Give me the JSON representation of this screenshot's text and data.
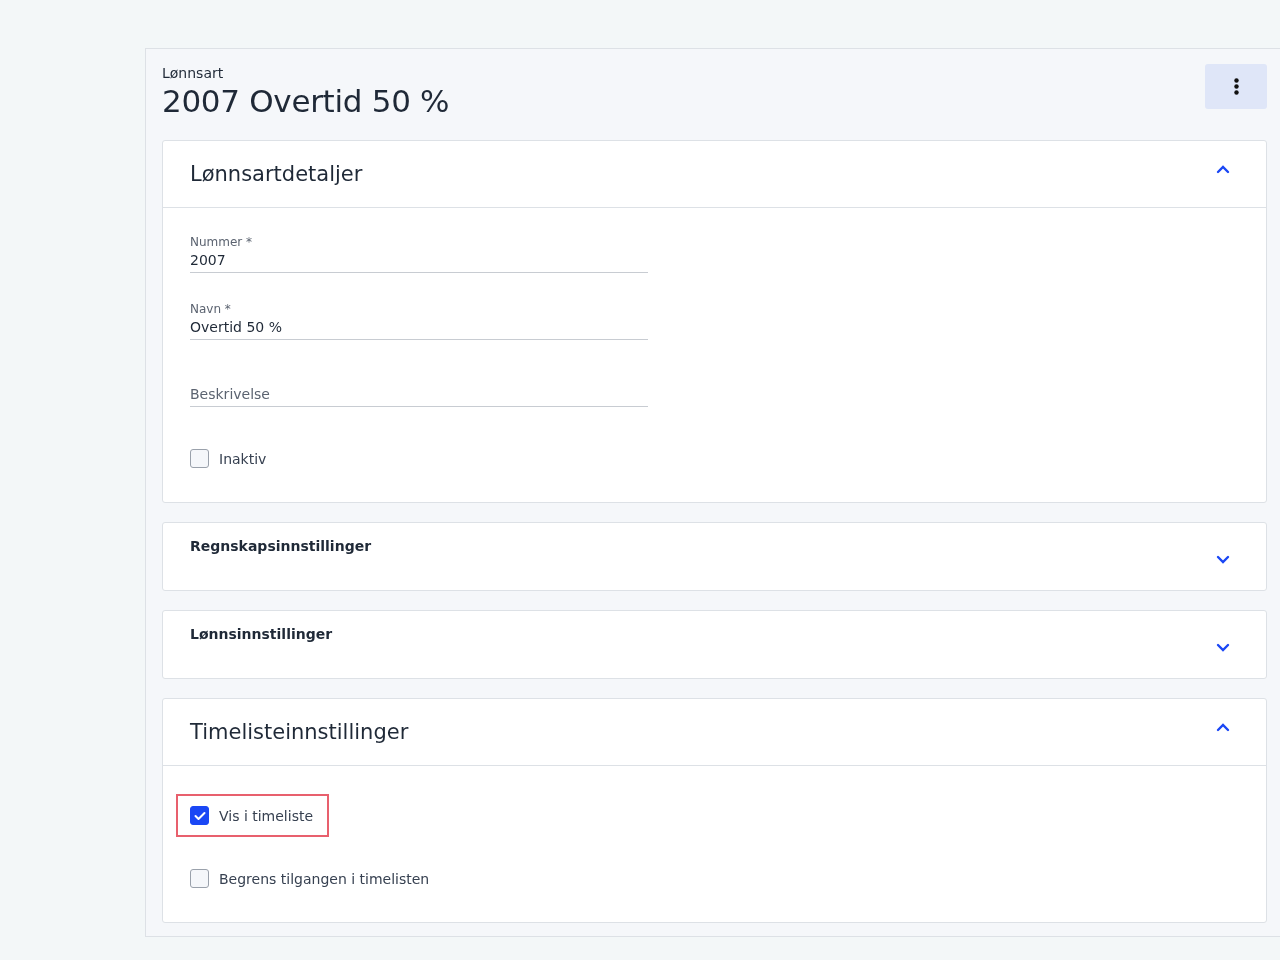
{
  "header": {
    "eyebrow": "Lønnsart",
    "title": "2007 Overtid 50 %"
  },
  "sections": [
    {
      "title": "Lønnsartdetaljer",
      "expanded": true,
      "items": [
        {
          "kind": "text",
          "label": "Nummer *",
          "value": "2007"
        },
        {
          "kind": "text",
          "label": "Navn *",
          "value": "Overtid 50 %"
        },
        {
          "kind": "text",
          "placeholder": "Beskrivelse"
        },
        {
          "kind": "checkbox",
          "label": "Inaktiv",
          "checked": false,
          "highlighted": false
        }
      ]
    },
    {
      "title": "Regnskapsinnstillinger",
      "expanded": false
    },
    {
      "title": "Lønnsinnstillinger",
      "expanded": false
    },
    {
      "title": "Timelisteinnstillinger",
      "expanded": true,
      "items": [
        {
          "kind": "checkbox",
          "label": "Vis i timeliste",
          "checked": true,
          "highlighted": true
        },
        {
          "kind": "checkbox",
          "label": "Begrens tilgangen i timelisten",
          "checked": false,
          "highlighted": false
        }
      ]
    }
  ]
}
